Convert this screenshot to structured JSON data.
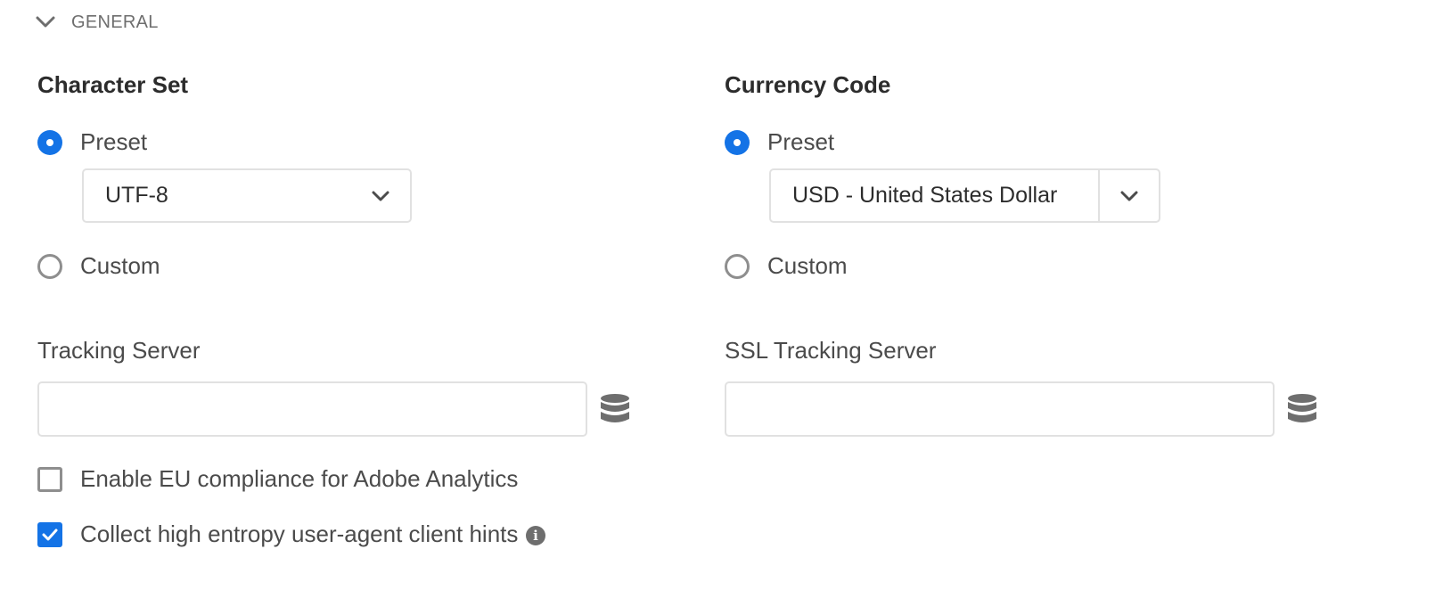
{
  "section": {
    "title": "GENERAL",
    "expanded": true,
    "icon": "chevron-down-icon"
  },
  "character_set": {
    "title": "Character Set",
    "preset_label": "Preset",
    "custom_label": "Custom",
    "selected": "preset",
    "preset_value": "UTF-8"
  },
  "currency_code": {
    "title": "Currency Code",
    "preset_label": "Preset",
    "custom_label": "Custom",
    "selected": "preset",
    "preset_value": "USD - United States Dollar"
  },
  "tracking_server": {
    "label": "Tracking Server",
    "value": "",
    "icon": "database-icon"
  },
  "ssl_tracking_server": {
    "label": "SSL Tracking Server",
    "value": "",
    "icon": "database-icon"
  },
  "eu_compliance": {
    "label": "Enable EU compliance for Adobe Analytics",
    "checked": false
  },
  "client_hints": {
    "label": "Collect high entropy user-agent client hints",
    "checked": true,
    "icon": "info-icon"
  },
  "colors": {
    "accent": "#1473e6",
    "border": "#e1e1e1",
    "icon_gray": "#6e6e6e"
  }
}
